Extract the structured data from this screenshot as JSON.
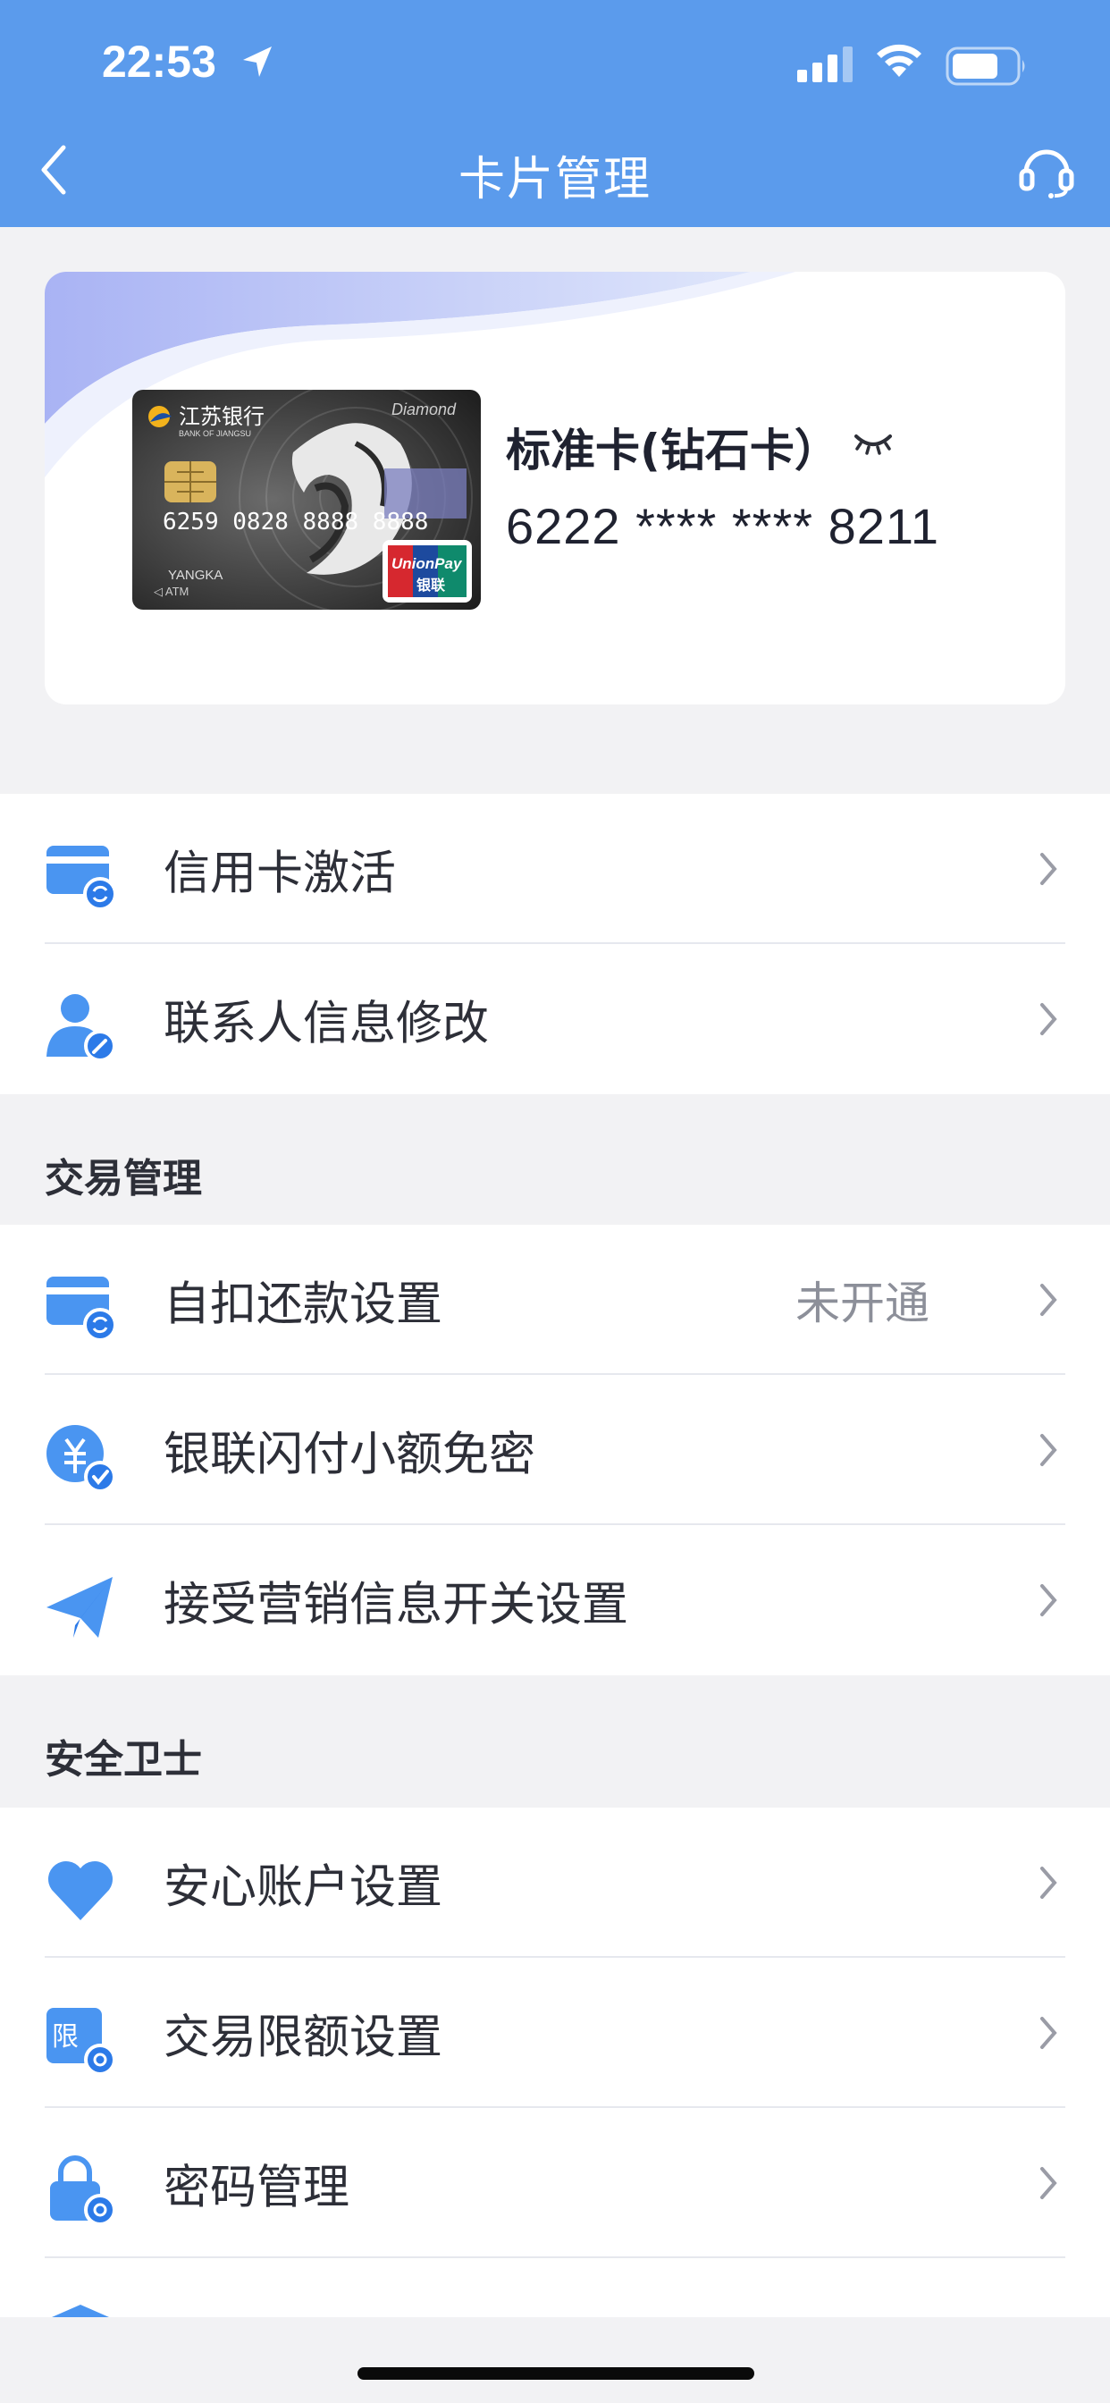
{
  "status_bar": {
    "time": "22:53",
    "icons": [
      "location-arrow-icon",
      "signal-icon",
      "wifi-icon",
      "battery-icon"
    ]
  },
  "header": {
    "title": "卡片管理",
    "back_icon": "chevron-left-icon",
    "service_icon": "headset-icon",
    "background_color": "#5b9bec"
  },
  "card": {
    "name": "标准卡(钻石卡）",
    "number": "6222 **** **** 8211",
    "image": {
      "bank_name": "江苏银行",
      "bank_name_en": "BANK OF JIANGSU",
      "tier": "Diamond",
      "card_digits": "6259 0828 8888 8888",
      "holder": "YANGKA",
      "network": "UnionPay",
      "network_cn": "银联"
    }
  },
  "groups": [
    {
      "items": [
        {
          "label": "信用卡激活",
          "icon": "card-refresh-icon"
        },
        {
          "label": "联系人信息修改",
          "icon": "contact-edit-icon"
        }
      ]
    },
    {
      "title": "交易管理",
      "items": [
        {
          "label": "自扣还款设置",
          "value": "未开通",
          "icon": "card-refresh-icon"
        },
        {
          "label": "银联闪付小额免密",
          "icon": "yuan-check-icon"
        },
        {
          "label": "接受营销信息开关设置",
          "icon": "paper-plane-icon"
        }
      ]
    },
    {
      "title": "安全卫士",
      "items": [
        {
          "label": "安心账户设置",
          "icon": "heart-icon"
        },
        {
          "label": "交易限额设置",
          "icon": "limit-gear-icon"
        },
        {
          "label": "密码管理",
          "icon": "lock-gear-icon"
        }
      ]
    }
  ],
  "colors": {
    "accent": "#5b9bec",
    "icon_blue": "#3f8cf0",
    "value_gray": "#8c8f99"
  }
}
